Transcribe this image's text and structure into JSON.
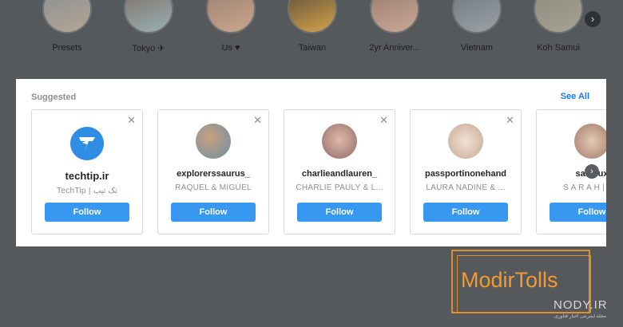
{
  "highlights": {
    "items": [
      {
        "label": "Presets",
        "colors": [
          "#8a8f94",
          "#b3a594"
        ]
      },
      {
        "label": "Tokyo ✈",
        "colors": [
          "#7d6e62",
          "#9ab0b6"
        ]
      },
      {
        "label": "Us ♥",
        "colors": [
          "#9b8172",
          "#caa58c"
        ]
      },
      {
        "label": "Taiwan",
        "colors": [
          "#5a4a3b",
          "#d2a34a"
        ]
      },
      {
        "label": "2yr Anniver...",
        "colors": [
          "#9a7a6b",
          "#c9a896"
        ]
      },
      {
        "label": "Vietnam",
        "colors": [
          "#6f767c",
          "#9aa2a6"
        ]
      },
      {
        "label": "Koh Samui",
        "colors": [
          "#8d8a7e",
          "#a5a293"
        ]
      }
    ],
    "next_icon": "chevron-right-icon"
  },
  "suggested": {
    "title": "Suggested",
    "see_all": "See All",
    "cards": [
      {
        "username": "techtip.ir",
        "fullname": "TechTip | تک تیپ",
        "follow": "Follow",
        "avatar": "techtip-logo",
        "color": "#2f8de4"
      },
      {
        "username": "explorerssaurus_",
        "fullname": "RAQUEL & MIGUEL",
        "follow": "Follow",
        "avatar": "photo",
        "colors": [
          "#6b8fa3",
          "#c9a07e"
        ]
      },
      {
        "username": "charlieandlauren_",
        "fullname": "CHARLIE PAULY & L...",
        "follow": "Follow",
        "avatar": "photo",
        "colors": [
          "#c79a94",
          "#8e6c6a"
        ]
      },
      {
        "username": "passportinonehand",
        "fullname": "LAURA NADINE & ...",
        "follow": "Follow",
        "avatar": "photo",
        "colors": [
          "#e5cfc0",
          "#c9a791"
        ]
      },
      {
        "username": "saltylux",
        "fullname": "S A R A H  |  T R",
        "follow": "Follow",
        "avatar": "photo",
        "colors": [
          "#d8b49e",
          "#9c7b68"
        ]
      }
    ],
    "close_icon": "close-icon",
    "next_icon": "chevron-right-icon"
  },
  "watermark": {
    "brand": "ModirTolls",
    "site": "NODY.IR",
    "sub": "مجله اینترنتی اخبار فناوری"
  }
}
